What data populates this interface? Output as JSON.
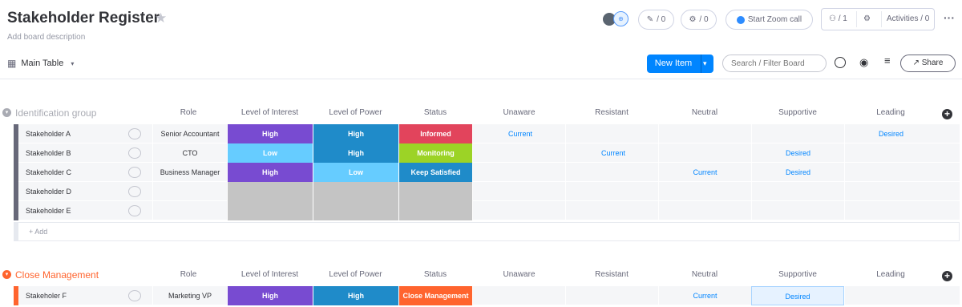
{
  "board": {
    "title": "Stakeholder Register",
    "description": "Add board description"
  },
  "header": {
    "updates_count": "/ 0",
    "integrations_count": "/ 0",
    "zoom_label": "Start Zoom call",
    "members_count": "/ 1",
    "activities_label": "Activities / 0"
  },
  "toolbar": {
    "view_label": "Main Table",
    "new_item_label": "New Item",
    "search_placeholder": "Search / Filter Board",
    "share_label": "Share"
  },
  "columns": [
    "Role",
    "Level of Interest",
    "Level of Power",
    "Status",
    "Unaware",
    "Resistant",
    "Neutral",
    "Supportive",
    "Leading"
  ],
  "colors": {
    "high": "#784bd1",
    "high_power": "#1f8bc9",
    "low": "#66ccff",
    "informed": "#e2445c",
    "monitoring": "#9cd326",
    "keep_satisfied": "#1f8bc9",
    "close_management": "#ff642e",
    "empty": "#c4c4c4",
    "group1": "#a9abb3",
    "group2": "#ff642e"
  },
  "groups": [
    {
      "name": "Identification group",
      "add_label": "+ Add",
      "rows": [
        {
          "name": "Stakeholder A",
          "role": "Senior Accountant",
          "interest": "High",
          "power": "High",
          "status": "Informed",
          "unaware": "Current",
          "resistant": "",
          "neutral": "",
          "supportive": "",
          "leading": "Desired"
        },
        {
          "name": "Stakeholder B",
          "role": "CTO",
          "interest": "Low",
          "power": "High",
          "status": "Monitoring",
          "unaware": "",
          "resistant": "Current",
          "neutral": "",
          "supportive": "Desired",
          "leading": ""
        },
        {
          "name": "Stakeholder C",
          "role": "Business Manager",
          "interest": "High",
          "power": "Low",
          "status": "Keep Satisfied",
          "unaware": "",
          "resistant": "",
          "neutral": "Current",
          "supportive": "Desired",
          "leading": ""
        },
        {
          "name": "Stakeholder D",
          "role": "",
          "interest": "",
          "power": "",
          "status": "",
          "unaware": "",
          "resistant": "",
          "neutral": "",
          "supportive": "",
          "leading": ""
        },
        {
          "name": "Stakeholder E",
          "role": "",
          "interest": "",
          "power": "",
          "status": "",
          "unaware": "",
          "resistant": "",
          "neutral": "",
          "supportive": "",
          "leading": ""
        }
      ]
    },
    {
      "name": "Close Management",
      "rows": [
        {
          "name": "Stakeholer F",
          "role": "Marketing VP",
          "interest": "High",
          "power": "High",
          "status": "Close Management",
          "unaware": "",
          "resistant": "",
          "neutral": "Current",
          "supportive": "Desired",
          "leading": ""
        }
      ]
    }
  ]
}
